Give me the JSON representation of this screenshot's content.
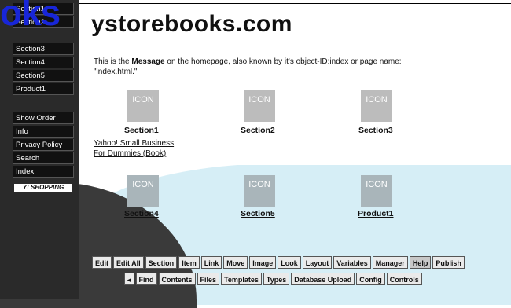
{
  "logo": {
    "text": "oks"
  },
  "site_title": "ystorebooks.com",
  "sidebar": {
    "top_items": [
      "Section1",
      "Section2",
      "Section3",
      "Section4",
      "Section5",
      "Product1"
    ],
    "bottom_items": [
      "Show Order",
      "Info",
      "Privacy Policy",
      "Search",
      "Index"
    ],
    "shopping_badge": "Y! SHOPPING"
  },
  "message": {
    "prefix": "This is the ",
    "bold": "Message",
    "suffix": " on the homepage, also known by it's object-ID:index or page name: \"index.html.\""
  },
  "icon_label": "ICON",
  "sections": [
    {
      "label": "Section1"
    },
    {
      "label": "Section2"
    },
    {
      "label": "Section3"
    },
    {
      "label": "Section4"
    },
    {
      "label": "Section5"
    },
    {
      "label": "Product1"
    }
  ],
  "book_link": {
    "line1": "Yahoo! Small Business",
    "line2": "For Dummies (Book)"
  },
  "toolbar_row1": [
    "Edit",
    "Edit All",
    "Section",
    "Item",
    "Link",
    "Move",
    "Image",
    "Look",
    "Layout",
    "Variables",
    "Manager",
    "Help",
    "Publish"
  ],
  "toolbar_row2": [
    "Find",
    "Contents",
    "Files",
    "Templates",
    "Types",
    "Database Upload",
    "Config",
    "Controls"
  ],
  "toolbar_back_arrow": "◂",
  "colors": {
    "logo": "#1826d8",
    "sidebar": "#111111",
    "cyan_background": "#d6eef6"
  }
}
